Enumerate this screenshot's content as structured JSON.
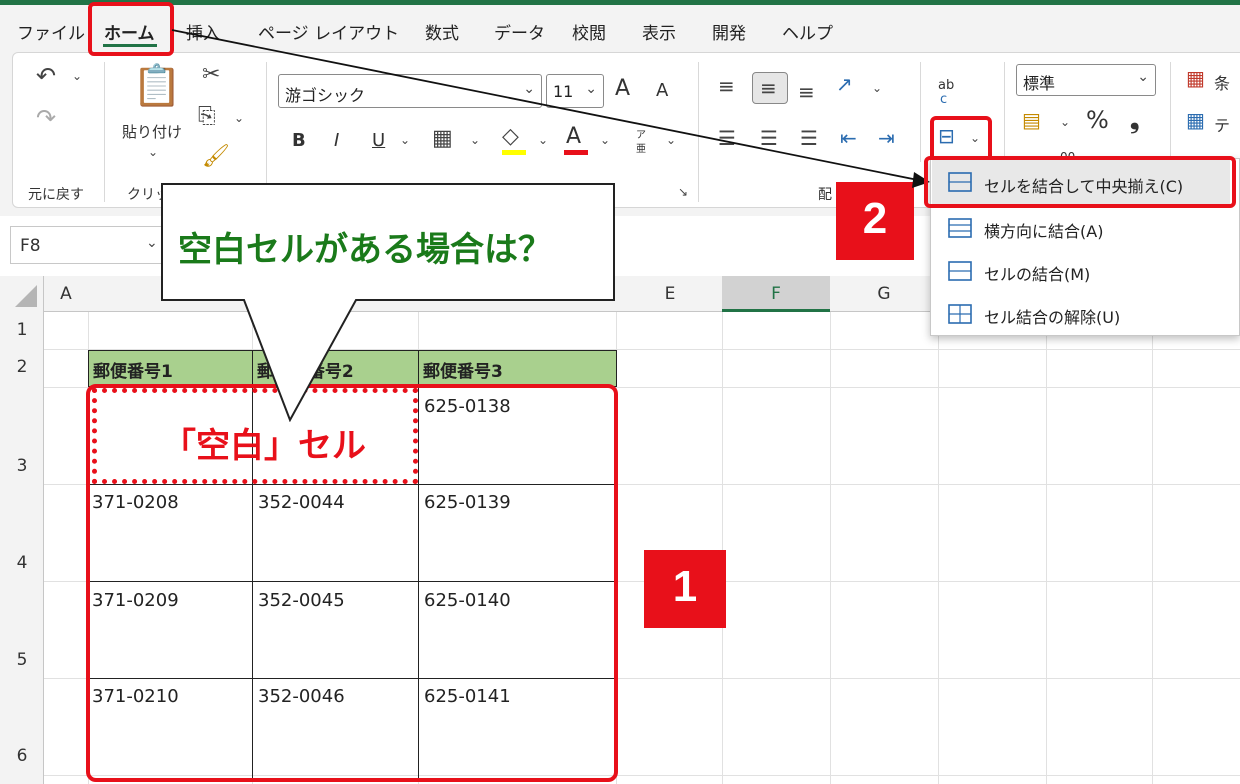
{
  "menu": {
    "tabs": [
      "ファイル",
      "ホーム",
      "挿入",
      "ページ レイアウト",
      "数式",
      "データ",
      "校閲",
      "表示",
      "開発",
      "ヘルプ"
    ],
    "active_tab": "ホーム"
  },
  "ribbon": {
    "undo_label": "元に戻す",
    "clipboard_label": "クリッ",
    "paste_label": "貼り付け",
    "font_name": "游ゴシック",
    "font_size": "11",
    "bold": "B",
    "italic": "I",
    "underline": "U",
    "font_color_glyph": "A",
    "phonetic_top": "ア",
    "phonetic_bottom": "亜",
    "grow_font": "A",
    "shrink_font": "A",
    "alignment_label_partial": "配",
    "number_format": "標準",
    "percent": "%",
    "comma": "❟",
    "conditional_format_partial": "条",
    "table_format_partial": "テ",
    "wrap_glyph_top": "ab",
    "wrap_glyph_bottom": "c",
    "zero_partial": "00"
  },
  "formula_bar": {
    "name_box": "F8"
  },
  "sheet": {
    "columns": [
      "A",
      "E",
      "F",
      "G"
    ],
    "rows": [
      "1",
      "2",
      "3",
      "4",
      "5",
      "6"
    ],
    "headers": [
      "郵便番号1",
      "郵便番号2",
      "郵便番号3"
    ],
    "data": [
      [
        "",
        "",
        "625-0138"
      ],
      [
        "371-0208",
        "352-0044",
        "625-0139"
      ],
      [
        "371-0209",
        "352-0045",
        "625-0140"
      ],
      [
        "371-0210",
        "352-0046",
        "625-0141"
      ]
    ],
    "header_col2_partial": "郵",
    "header_col2_tail": "番号2"
  },
  "merge_menu": {
    "items": [
      "セルを結合して中央揃え(C)",
      "横方向に結合(A)",
      "セルの結合(M)",
      "セル結合の解除(U)"
    ]
  },
  "annotations": {
    "callout": "空白セルがある場合は？",
    "blank_label": "「空白」セル",
    "badge1": "1",
    "badge2": "2",
    "callout_color": "#1a7a1a",
    "highlight_color": "#e8101a"
  }
}
